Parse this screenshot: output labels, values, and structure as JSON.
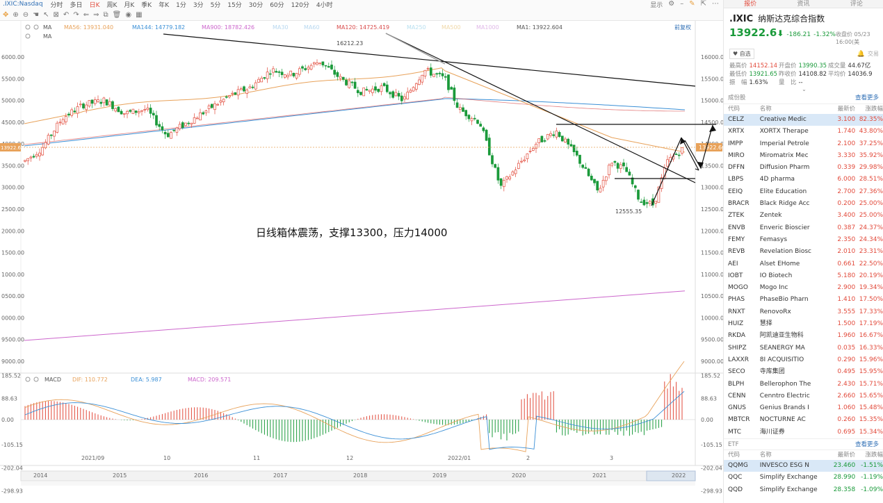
{
  "toolbar": {
    "symbol": ".IXIC:Nasdaq",
    "periods": [
      "分时",
      "多日",
      "日K",
      "周K",
      "月K",
      "季K",
      "年K",
      "1分",
      "3分",
      "5分",
      "15分",
      "30分",
      "60分",
      "120分",
      "4小时"
    ],
    "active_period": "日K",
    "right_label": "显示"
  },
  "indicators": {
    "ma_label": "MA",
    "ma56": "MA56: 13931.040",
    "ma144": "MA144: 14779.182",
    "ma900": "MA900: 18782.426",
    "ma_a": "MA30",
    "ma_b": "MA60",
    "ma120": "MA120: 14725.419",
    "ma_c": "MA250",
    "ma_d": "MA500",
    "ma_e": "MA1000",
    "ma1": "MA1: 13922.604",
    "adjust": "前复权",
    "ma2_label": "MA"
  },
  "price_axis": [
    "16000.00",
    "15500.00",
    "15000.00",
    "14500.00",
    "14000.00",
    "13500.00",
    "13000.00",
    "12500.00",
    "12000.00",
    "11500.00",
    "11000.00",
    "10500.00",
    "10000.00",
    "9500.00",
    "9000.00"
  ],
  "left_axis": [
    "6000.00",
    "5500.00",
    "5000.00",
    "4500.00",
    "4000.00",
    "3500.00",
    "3000.00",
    "2500.00",
    "2000.00",
    "1500.00",
    "1000.00",
    "0500.00",
    "0000.00",
    "9500.00",
    "9000.00"
  ],
  "current_price_tag": "13922.60",
  "annotations": {
    "high": "16212.23",
    "low": "12555.35",
    "comment": "日线箱体震荡，支撑13300，压力14000"
  },
  "macd": {
    "label": "MACD",
    "dif": "DIF: 110.772",
    "dea": "DEA: 5.987",
    "macd": "MACD: 209.571",
    "axis_right": [
      "185.52",
      "88.63",
      "0.00",
      "-105.15",
      "-202.04",
      "-298.93"
    ],
    "axis_left": [
      "185.52",
      "88.63",
      "0.00",
      "-105.15",
      "-202.04",
      "-298.93"
    ]
  },
  "time_axis_top": [
    "2021/09",
    "10",
    "11",
    "12",
    "2022/01",
    "2",
    "3"
  ],
  "time_axis_bottom": [
    "2014",
    "2015",
    "2016",
    "2017",
    "2018",
    "2019",
    "2020",
    "2021",
    "2022"
  ],
  "panel": {
    "tabs": [
      "报价",
      "资讯",
      "评论"
    ],
    "active_tab": "报价",
    "code": ".IXIC",
    "name": "纳斯达克综合指数",
    "price": "13922.6",
    "change": "-186.21",
    "change_pct": "-1.32%",
    "time": "收盘价 05/23 16:00(美",
    "fav": "自选",
    "trade": "交易",
    "stats": [
      [
        {
          "l": "最高价",
          "v": "14152.14",
          "c": "red"
        },
        {
          "l": "开盘价",
          "v": "13990.35",
          "c": "green"
        },
        {
          "l": "成交量",
          "v": "44.67亿",
          "c": ""
        }
      ],
      [
        {
          "l": "最低价",
          "v": "13921.65",
          "c": "green"
        },
        {
          "l": "昨收价",
          "v": "14108.82",
          "c": ""
        },
        {
          "l": "平均价",
          "v": "14036.9",
          "c": ""
        }
      ],
      [
        {
          "l": "振　幅",
          "v": "1.63%",
          "c": ""
        },
        {
          "l": "量　比",
          "v": "--",
          "c": ""
        },
        {
          "l": "",
          "v": "",
          "c": ""
        }
      ]
    ],
    "section1": "成份股",
    "section1_link": "查看更多",
    "cols": [
      "代码",
      "名称",
      "最新价",
      "涨跌幅"
    ],
    "rows": [
      {
        "code": "CELZ",
        "name": "Creative Medic",
        "price": "3.100",
        "chg": "82.35%",
        "up": true
      },
      {
        "code": "XRTX",
        "name": "XORTX Therape",
        "price": "1.740",
        "chg": "43.80%",
        "up": true
      },
      {
        "code": "IMPP",
        "name": "Imperial Petrole",
        "price": "2.100",
        "chg": "37.25%",
        "up": true
      },
      {
        "code": "MIRO",
        "name": "Miromatrix Mec",
        "price": "3.330",
        "chg": "35.92%",
        "up": true
      },
      {
        "code": "DFFN",
        "name": "Diffusion Pharm",
        "price": "0.339",
        "chg": "29.98%",
        "up": true
      },
      {
        "code": "LBPS",
        "name": "4D pharma",
        "price": "6.000",
        "chg": "28.51%",
        "up": true
      },
      {
        "code": "EEIQ",
        "name": "Elite Education",
        "price": "2.700",
        "chg": "27.36%",
        "up": true
      },
      {
        "code": "BRACR",
        "name": "Black Ridge Acc",
        "price": "0.200",
        "chg": "25.00%",
        "up": true
      },
      {
        "code": "ZTEK",
        "name": "Zentek",
        "price": "3.400",
        "chg": "25.00%",
        "up": true
      },
      {
        "code": "ENVB",
        "name": "Enveric Bioscier",
        "price": "0.387",
        "chg": "24.37%",
        "up": true
      },
      {
        "code": "FEMY",
        "name": "Femasys",
        "price": "2.350",
        "chg": "24.34%",
        "up": true
      },
      {
        "code": "REVB",
        "name": "Revelation Biosc",
        "price": "2.010",
        "chg": "23.31%",
        "up": true
      },
      {
        "code": "AEI",
        "name": "Alset EHome",
        "price": "0.661",
        "chg": "22.50%",
        "up": true
      },
      {
        "code": "IOBT",
        "name": "IO Biotech",
        "price": "5.180",
        "chg": "20.19%",
        "up": true
      },
      {
        "code": "MOGO",
        "name": "Mogo Inc",
        "price": "2.900",
        "chg": "19.34%",
        "up": true
      },
      {
        "code": "PHAS",
        "name": "PhaseBio Pharn",
        "price": "1.410",
        "chg": "17.50%",
        "up": true
      },
      {
        "code": "RNXT",
        "name": "RenovoRx",
        "price": "3.555",
        "chg": "17.33%",
        "up": true
      },
      {
        "code": "HUIZ",
        "name": "慧择",
        "price": "1.500",
        "chg": "17.19%",
        "up": true
      },
      {
        "code": "RKDA",
        "name": "阿凯迪亚生物科",
        "price": "1.960",
        "chg": "16.67%",
        "up": true
      },
      {
        "code": "SHIPZ",
        "name": "SEANERGY MA",
        "price": "0.035",
        "chg": "16.33%",
        "up": true
      },
      {
        "code": "LAXXR",
        "name": "8I ACQUISITIO",
        "price": "0.290",
        "chg": "15.96%",
        "up": true
      },
      {
        "code": "SECO",
        "name": "寺库集团",
        "price": "0.495",
        "chg": "15.95%",
        "up": true
      },
      {
        "code": "BLPH",
        "name": "Bellerophon The",
        "price": "2.430",
        "chg": "15.71%",
        "up": true
      },
      {
        "code": "CENN",
        "name": "Cenntro Electric",
        "price": "2.660",
        "chg": "15.65%",
        "up": true
      },
      {
        "code": "GNUS",
        "name": "Genius Brands I",
        "price": "1.060",
        "chg": "15.48%",
        "up": true
      },
      {
        "code": "MBTCR",
        "name": "NOCTURNE AC",
        "price": "0.260",
        "chg": "15.35%",
        "up": true
      },
      {
        "code": "MTC",
        "name": "海川证券",
        "price": "0.695",
        "chg": "15.34%",
        "up": true
      }
    ],
    "section2": "ETF",
    "section2_link": "查看更多",
    "etf_rows": [
      {
        "code": "QQMG",
        "name": "INVESCO ESG N",
        "price": "23.460",
        "chg": "-1.51%",
        "up": false
      },
      {
        "code": "QQC",
        "name": "Simplify Exchange",
        "price": "28.990",
        "chg": "-1.19%",
        "up": false
      },
      {
        "code": "QQD",
        "name": "Simplify Exchange",
        "price": "28.358",
        "chg": "-1.09%",
        "up": false
      }
    ]
  },
  "colors": {
    "up": "#e24a3b",
    "down": "#1a9a3a",
    "ma56": "#e8a25a",
    "ma144": "#3a8fd6",
    "ma900": "#cc66cc",
    "ma120": "#d94a4a",
    "dif": "#e8a25a",
    "dea": "#3a8fd6"
  }
}
